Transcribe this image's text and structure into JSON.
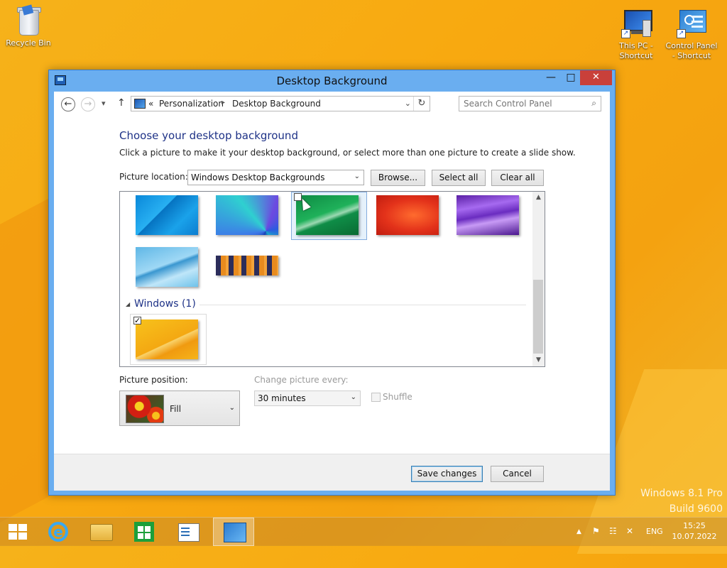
{
  "desktop": {
    "icons": [
      {
        "label": "Recycle Bin"
      },
      {
        "label": "This PC - Shortcut"
      },
      {
        "label": "Control Panel - Shortcut"
      }
    ],
    "watermark": {
      "line1": "Windows 8.1 Pro",
      "line2": "Build 9600"
    }
  },
  "window": {
    "title": "Desktop Background",
    "controls": {
      "minimize": "—",
      "maximize": "□",
      "close": "✕"
    },
    "nav": {
      "back_icon": "←",
      "forward_icon": "→",
      "recent_icon": "▾",
      "up_icon": "↑"
    },
    "address": {
      "overflow": "«",
      "crumbs": [
        "Personalization",
        "Desktop Background"
      ],
      "separator": "▸",
      "dropdown_icon": "⌄",
      "refresh_icon": "↻"
    },
    "search": {
      "placeholder": "Search Control Panel",
      "icon": "⌕"
    },
    "heading": "Choose your desktop background",
    "description": "Click a picture to make it your desktop background, or select more than one picture to create a slide show.",
    "picture_location": {
      "label": "Picture location:",
      "value": "Windows Desktop Backgrounds",
      "browse": "Browse...",
      "select_all": "Select all",
      "clear_all": "Clear all"
    },
    "pictures": {
      "group_label": "Windows (1)",
      "items": [
        {
          "name": "blue-lines",
          "checked": false
        },
        {
          "name": "blue-fan",
          "checked": false
        },
        {
          "name": "green-wave",
          "checked": false,
          "hovered": true
        },
        {
          "name": "red-abstract",
          "checked": false
        },
        {
          "name": "purple-waves",
          "checked": false
        },
        {
          "name": "light-blue-curve",
          "checked": false
        },
        {
          "name": "city-lights",
          "checked": false
        },
        {
          "name": "yellow-windows",
          "checked": true
        }
      ],
      "check_mark": "✓"
    },
    "picture_position": {
      "label": "Picture position:",
      "value": "Fill"
    },
    "change_picture": {
      "label": "Change picture every:",
      "value": "30 minutes"
    },
    "shuffle": {
      "label": "Shuffle",
      "checked": false
    },
    "footer": {
      "save": "Save changes",
      "cancel": "Cancel"
    }
  },
  "taskbar": {
    "tray": {
      "chevron": "▲",
      "flag": "⚑",
      "lang": "ENG"
    },
    "clock": {
      "time": "15:25",
      "date": "10.07.2022"
    }
  }
}
